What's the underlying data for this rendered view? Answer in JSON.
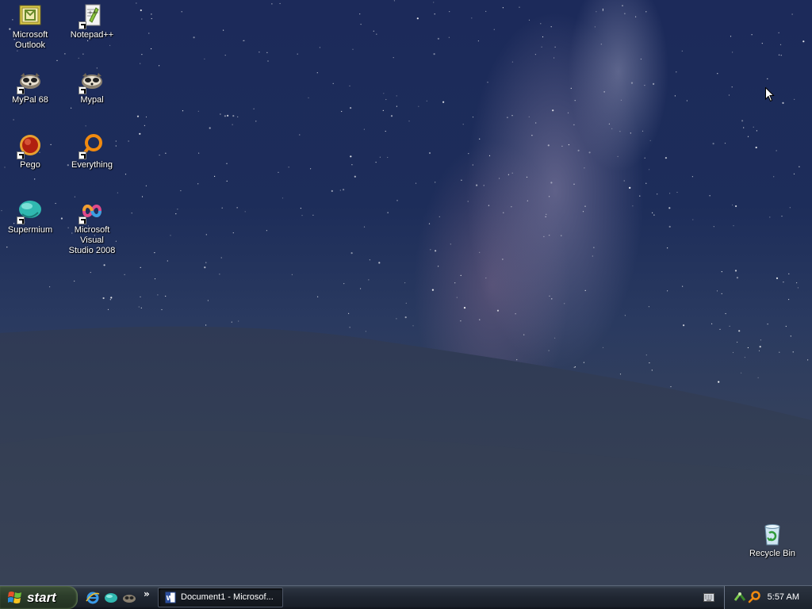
{
  "desktop": {
    "icons": [
      {
        "label": "Microsoft\nOutlook",
        "icon": "outlook-icon"
      },
      {
        "label": "Notepad++",
        "icon": "notepad-plus-plus-icon"
      },
      {
        "label": "MyPal 68",
        "icon": "mypal-icon"
      },
      {
        "label": "Mypal",
        "icon": "mypal-icon"
      },
      {
        "label": "Pego",
        "icon": "pego-icon"
      },
      {
        "label": "Everything",
        "icon": "everything-search-icon"
      },
      {
        "label": "Supermium",
        "icon": "supermium-icon"
      },
      {
        "label": "Microsoft Visual\nStudio 2008",
        "icon": "visual-studio-icon"
      },
      {
        "label": "Recycle Bin",
        "icon": "recycle-bin-icon"
      }
    ]
  },
  "taskbar": {
    "start_label": "start",
    "quick_launch": [
      {
        "icon": "internet-explorer-icon"
      },
      {
        "icon": "supermium-icon"
      },
      {
        "icon": "mypal-icon"
      }
    ],
    "chevron": "»",
    "tasks": [
      {
        "label": "Document1 - Microsof...",
        "icon": "word-document-icon"
      }
    ],
    "tray": {
      "icons": [
        "network-icon",
        "everything-search-icon"
      ],
      "clock": "5:57 AM"
    }
  },
  "colors": {
    "sky": "#1d2d5a",
    "hill": "#33405d",
    "taskbar": "#1f2631",
    "start_button": "#2d3e2b"
  }
}
